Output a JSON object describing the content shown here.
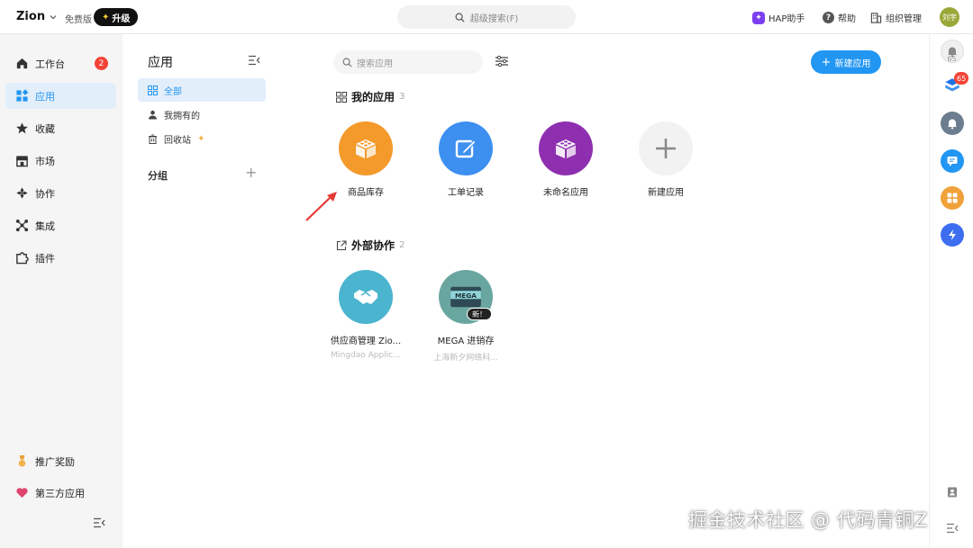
{
  "topbar": {
    "brand": "Zion",
    "edition": "免费版",
    "upgrade_label": "升级",
    "search_placeholder": "超级搜索(F)",
    "hap_label": "HAP助手",
    "help_label": "帮助",
    "org_label": "组织管理",
    "user_initials": "刘宇"
  },
  "nav": {
    "items": [
      {
        "label": "工作台",
        "badge": "2"
      },
      {
        "label": "应用"
      },
      {
        "label": "收藏"
      },
      {
        "label": "市场"
      },
      {
        "label": "协作"
      },
      {
        "label": "集成"
      },
      {
        "label": "插件"
      }
    ],
    "bottom": [
      {
        "label": "推广奖励"
      },
      {
        "label": "第三方应用"
      }
    ]
  },
  "subpanel": {
    "title": "应用",
    "items": [
      {
        "label": "全部"
      },
      {
        "label": "我拥有的"
      },
      {
        "label": "回收站"
      }
    ],
    "group_label": "分组"
  },
  "main": {
    "search_placeholder": "搜索应用",
    "new_app_label": "新建应用",
    "my_apps": {
      "title": "我的应用",
      "count": "3",
      "apps": [
        {
          "name": "商品库存",
          "color": "#f39a2b"
        },
        {
          "name": "工单记录",
          "color": "#3d8ff0"
        },
        {
          "name": "未命名应用",
          "color": "#8e2fb0"
        },
        {
          "name": "新建应用",
          "color": "#f2f2f2"
        }
      ]
    },
    "external": {
      "title": "外部协作",
      "count": "2",
      "apps": [
        {
          "name": "供应商管理 Zio...",
          "sub": "Mingdao Applic...",
          "color": "#4bb4cf"
        },
        {
          "name": "MEGA 进销存",
          "sub": "上海新夕网络科...",
          "color": "#6aa6a0",
          "tag": "新！",
          "logo_text": "MEGA"
        }
      ]
    }
  },
  "rail": {
    "notif_count": "65",
    "badge_count": "65"
  },
  "watermark": "掘金技术社区 @ 代码青铜Z"
}
